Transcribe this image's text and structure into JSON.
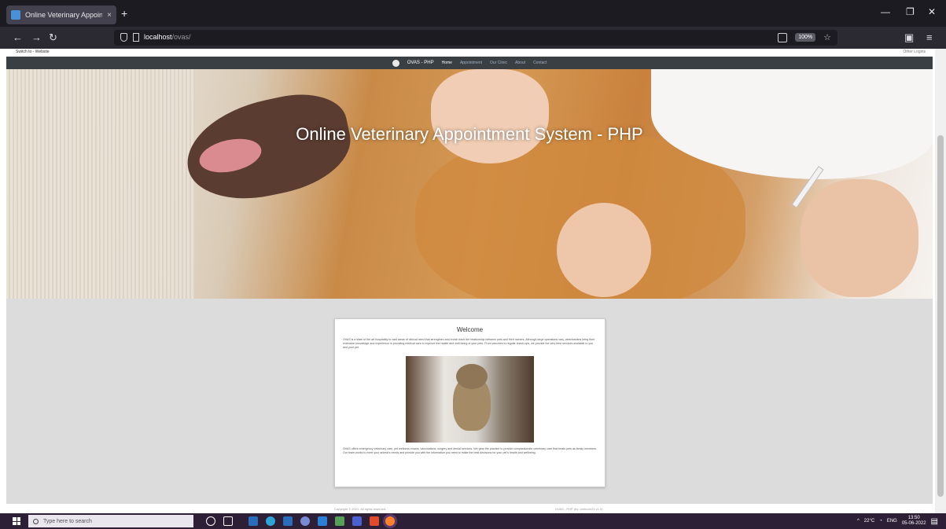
{
  "browser": {
    "tab_title": "Online Veterinary Appointment",
    "tab_close": "×",
    "new_tab": "+",
    "url_host": "localhost",
    "url_path": "/ovas/",
    "zoom_badge": "100%",
    "window_minimize": "—",
    "window_restore": "❐",
    "window_close": "✕"
  },
  "infobar": {
    "left": "Switch to - Website",
    "right": "Other Logins"
  },
  "site": {
    "brand": "OVAS - PHP",
    "nav": [
      "Home",
      "Appointment",
      "Our Clinic",
      "About",
      "Contact"
    ],
    "hero_title": "Online Veterinary Appointment System - PHP",
    "card_title": "Welcome",
    "card_text_1": "OVAS is a state of the art hospitality to vast areas of clinical need that strengthen and enrich each the relationship between pets and their owners. Although large operations vary, veterinarians bring their extensive knowledge and experience in providing medical care to improve the health and well-being of your pets. From vaccines to regular check-ups, we provide the very best services available to you and your pet.",
    "card_text_2": "OVAS offers emergency veterinary care, pet wellness exams, vaccinations, surgery and dental services. We gear the practice to provide compassionate veterinary care that treats pets as family members. Our team works to meet your animal's needs and provide you with the information you need to make the best decisions for your pet's health and wellbeing.",
    "footer_left": "Copyright © 2021. All rights reserved.",
    "footer_right": "OVAS - PHP (by: oretnom23 v1.0)"
  },
  "taskbar": {
    "search_placeholder": "Type here to search",
    "weather": "22°C",
    "lang": "ENG",
    "time": "13:50",
    "date": "05-06-2022"
  }
}
